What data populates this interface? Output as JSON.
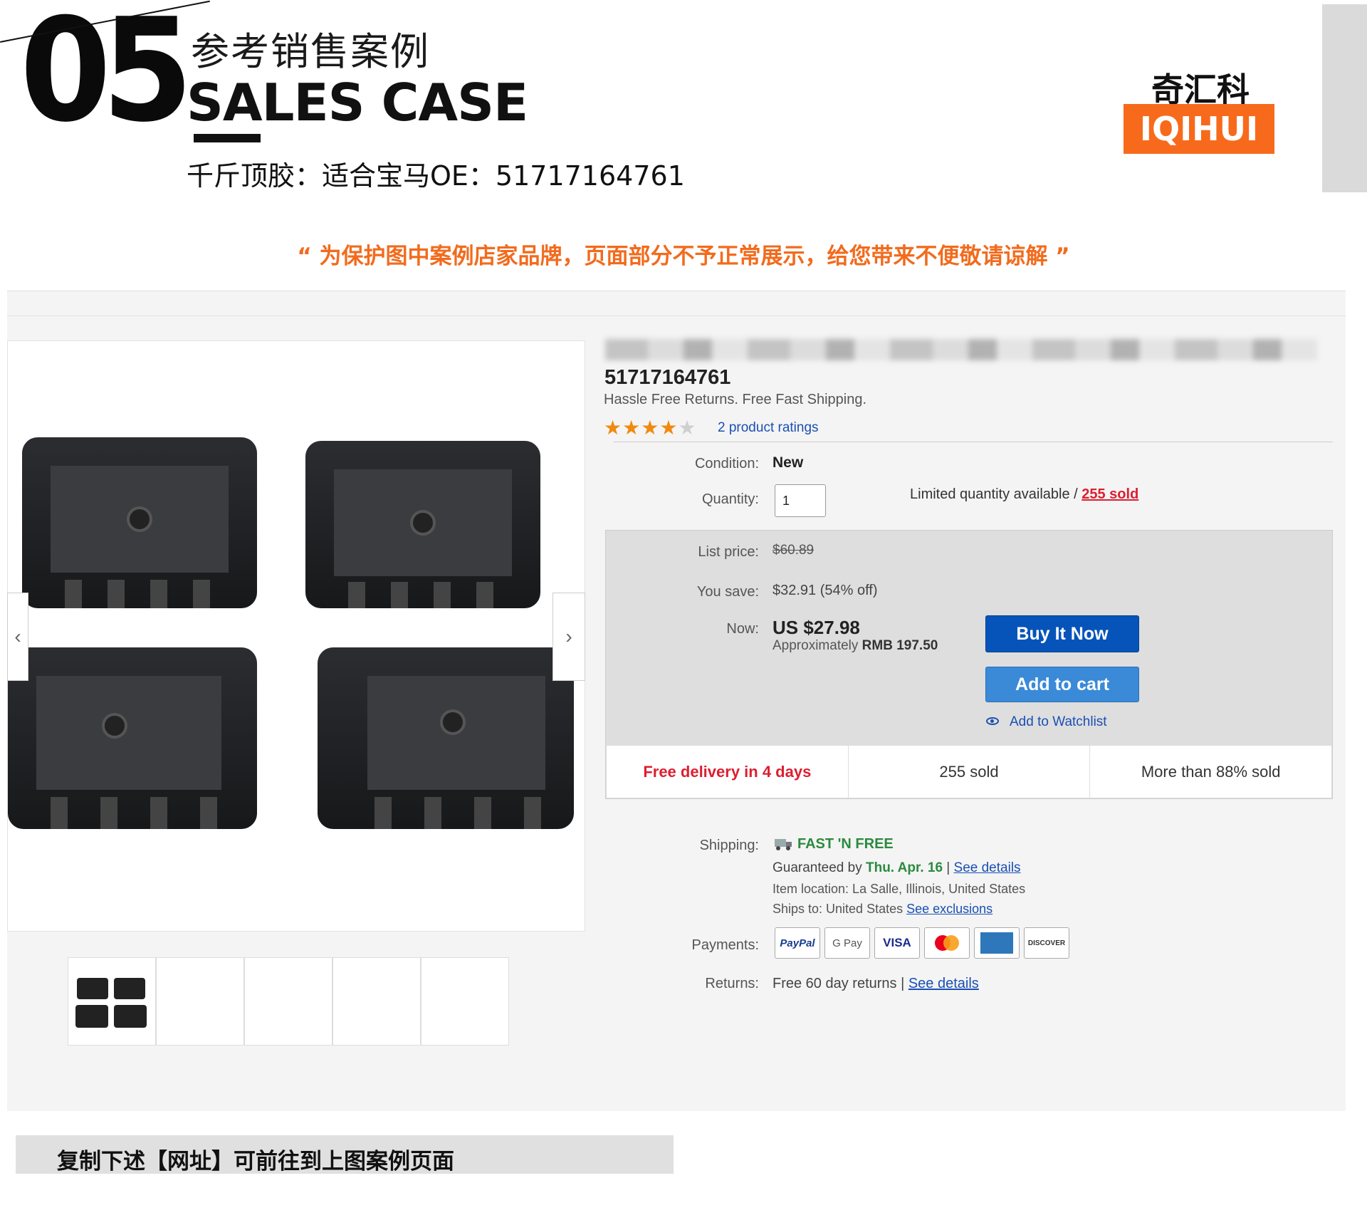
{
  "header": {
    "number": "05",
    "title_cn": "参考销售案例",
    "title_en": "SALES CASE",
    "subtitle": "千斤顶胶：适合宝马OE：51717164761"
  },
  "brand": {
    "name_cn": "奇汇科技",
    "name_en": "IQIHUI",
    "accent_color": "#f76a1c"
  },
  "notice": "“ 为保护图中案例店家品牌，页面部分不予正常展示，给您带来不便敬请谅解 ”",
  "listing": {
    "item_number": "51717164761",
    "tagline": "Hassle Free Returns. Free Fast Shipping.",
    "rating_stars": 4,
    "rating_max": 5,
    "ratings_link": "2 product ratings",
    "condition_label": "Condition:",
    "condition_value": "New",
    "quantity_label": "Quantity:",
    "quantity_value": "1",
    "limited_text": "Limited quantity available / ",
    "sold_link": "255 sold",
    "list_price_label": "List price:",
    "list_price": "$60.89",
    "you_save_label": "You save:",
    "you_save": "$32.91 (54% off)",
    "now_label": "Now:",
    "now_price": "US $27.98",
    "approx_prefix": "Approximately ",
    "approx_value": "RMB 197.50",
    "buy_now": "Buy It Now",
    "add_to_cart": "Add to cart",
    "watchlist": "Add to Watchlist",
    "stats": [
      "Free delivery in 4 days",
      "255 sold",
      "More than 88% sold"
    ],
    "shipping_label": "Shipping:",
    "shipping_badge": "FAST 'N FREE",
    "guarantee_prefix": "Guaranteed by ",
    "guarantee_date": "Thu. Apr. 16",
    "guarantee_sep": " | ",
    "see_details": "See details",
    "item_location": "Item location: La Salle, Illinois, United States",
    "ships_to": "Ships to: United States  ",
    "see_exclusions": "See exclusions",
    "payments_label": "Payments:",
    "payments": [
      "PayPal",
      "G Pay",
      "VISA",
      "Mastercard",
      "AMEX",
      "DISCOVER"
    ],
    "returns_label": "Returns:",
    "returns_text": "Free 60 day returns | ",
    "returns_link": "See details"
  },
  "footer": {
    "copy_text": "复制下述【网址】可前往到上图案例页面"
  }
}
